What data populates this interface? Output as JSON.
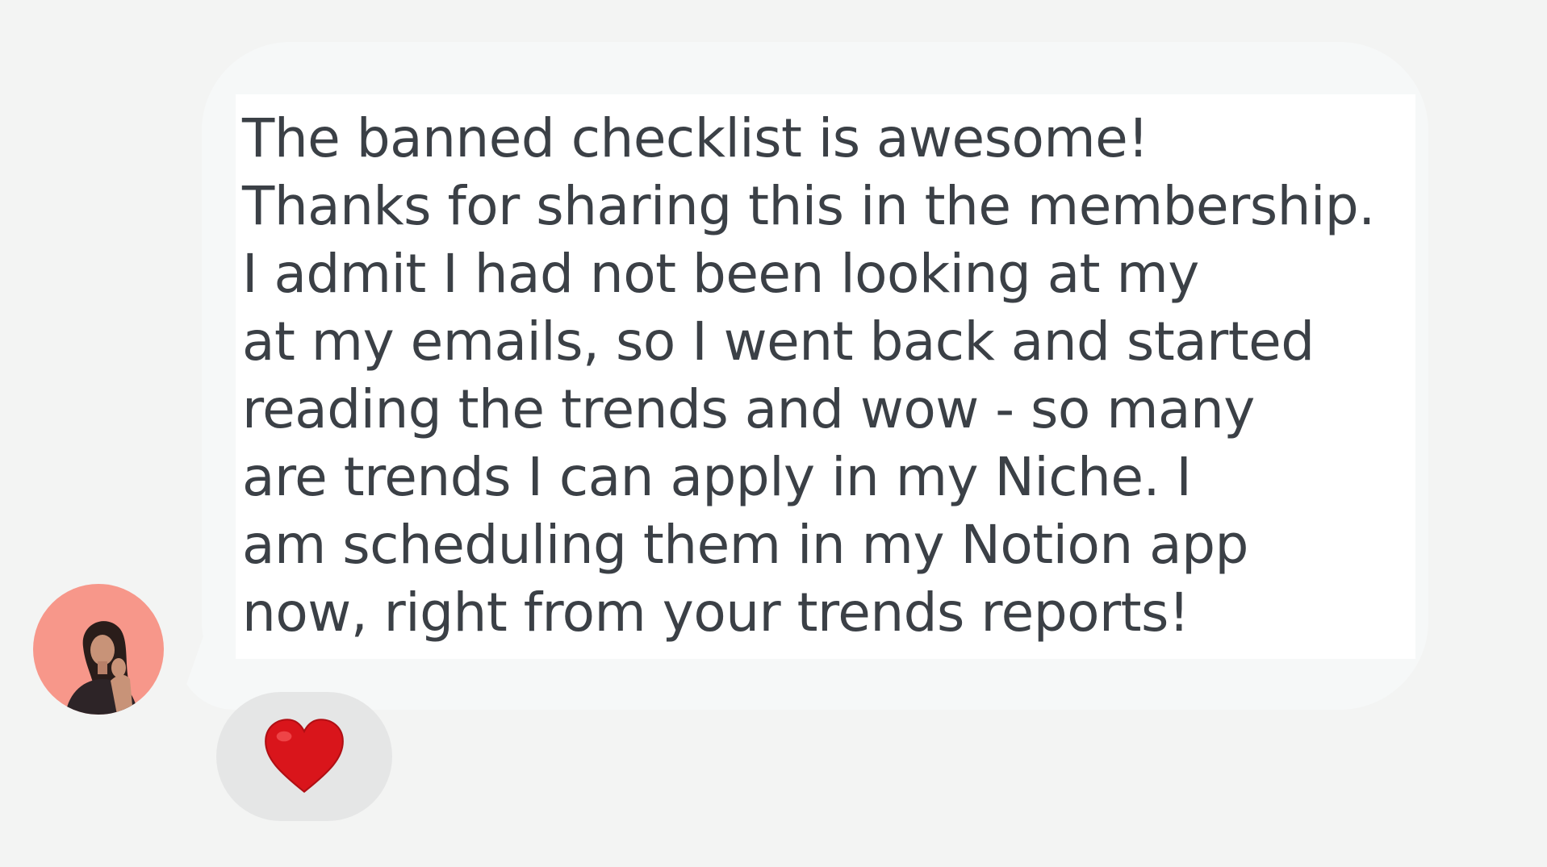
{
  "message": {
    "lines": [
      "The banned checklist is awesome!",
      "Thanks for sharing this in the membership.",
      "I admit I had not been looking at my",
      "at my emails, so I went back and started",
      "reading the trends and wow - so many",
      "are trends I can apply in my Niche. I",
      "am scheduling them in my Notion app",
      "now, right from your trends reports!"
    ]
  },
  "avatar": {
    "background_color": "#f7978a"
  },
  "reaction": {
    "icon": "red-heart-icon",
    "color": "#e0161c"
  },
  "colors": {
    "page_background": "#f3f4f3",
    "bubble_background": "#f6f8f8",
    "text": "#3b4046",
    "reaction_pill": "#e5e6e6"
  }
}
